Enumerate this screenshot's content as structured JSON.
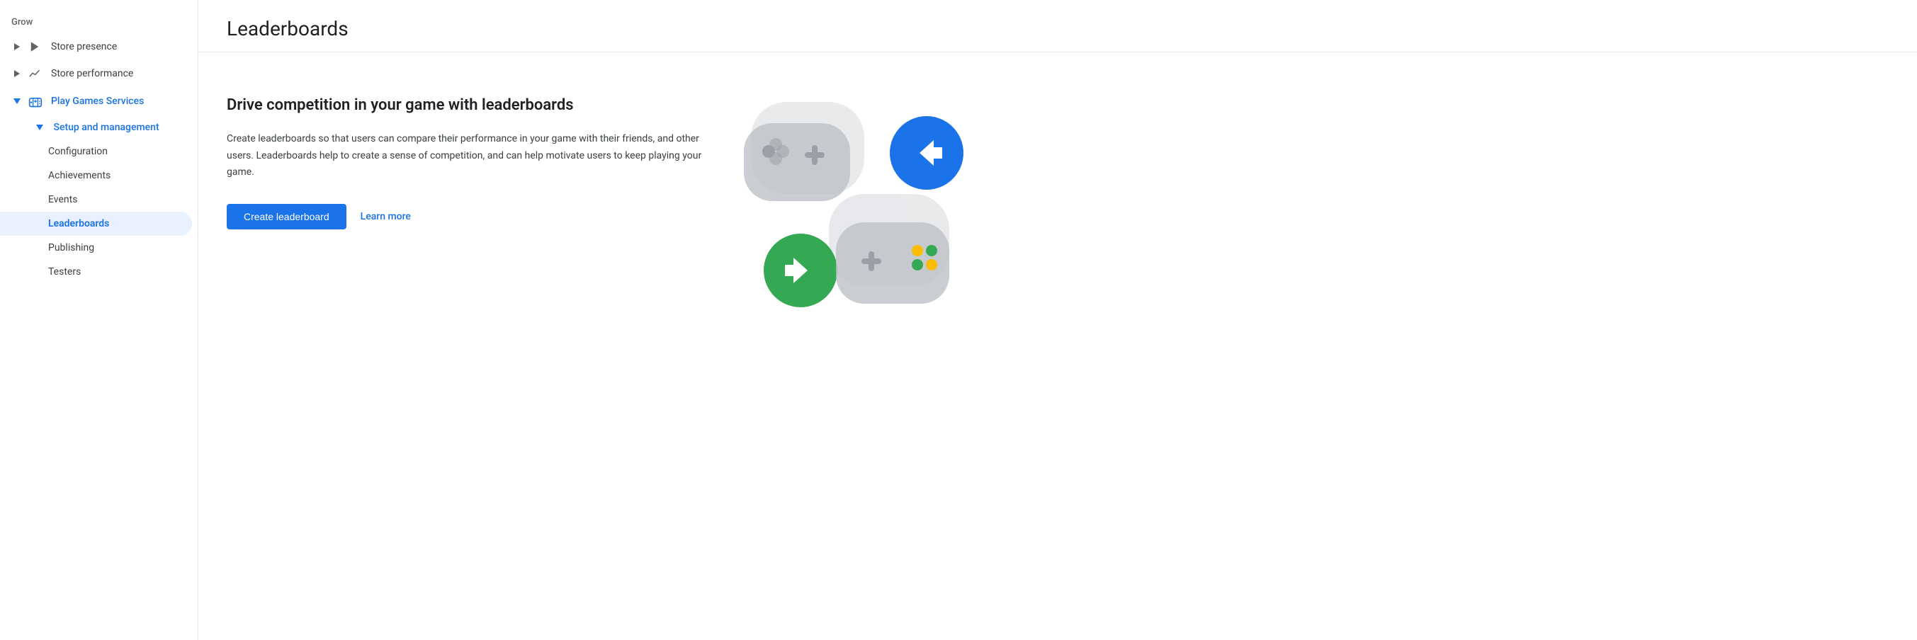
{
  "sidebar": {
    "grow_label": "Grow",
    "items": [
      {
        "id": "store-presence",
        "label": "Store presence",
        "icon": "play-icon",
        "expanded": false,
        "level": 1
      },
      {
        "id": "store-performance",
        "label": "Store performance",
        "icon": "trending-icon",
        "expanded": false,
        "level": 1
      },
      {
        "id": "play-games-services",
        "label": "Play Games Services",
        "icon": "gamepad-icon",
        "expanded": true,
        "level": 1,
        "active_blue": true
      },
      {
        "id": "setup-and-management",
        "label": "Setup and management",
        "icon": "",
        "expanded": true,
        "level": 2,
        "active_blue": true
      },
      {
        "id": "configuration",
        "label": "Configuration",
        "level": 3
      },
      {
        "id": "achievements",
        "label": "Achievements",
        "level": 3
      },
      {
        "id": "events",
        "label": "Events",
        "level": 3
      },
      {
        "id": "leaderboards",
        "label": "Leaderboards",
        "level": 3,
        "active": true
      },
      {
        "id": "publishing",
        "label": "Publishing",
        "level": 3
      },
      {
        "id": "testers",
        "label": "Testers",
        "level": 3
      }
    ]
  },
  "page": {
    "title": "Leaderboards",
    "heading": "Drive competition in your game with leaderboards",
    "description": "Create leaderboards so that users can compare their performance in your game with their friends, and other users. Leaderboards help to create a sense of competition, and can help motivate users to keep playing your game.",
    "create_button": "Create leaderboard",
    "learn_more_link": "Learn more"
  }
}
